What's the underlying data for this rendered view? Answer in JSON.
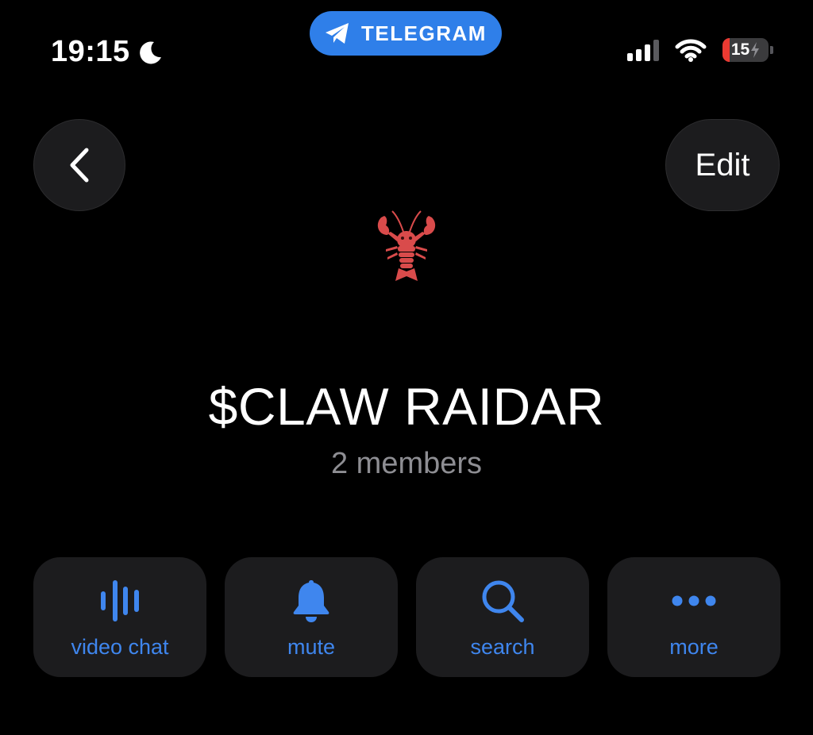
{
  "status_bar": {
    "time": "19:15",
    "app_pill_label": "TELEGRAM",
    "battery_level": "15",
    "battery_fraction": 0.15,
    "accent": "#2f7fe9"
  },
  "nav": {
    "back_icon": "chevron-left-icon",
    "edit_label": "Edit"
  },
  "profile": {
    "avatar_icon": "lobster-icon",
    "title": "$CLAW RAIDAR",
    "subtitle": "2 members"
  },
  "actions": [
    {
      "label": "video chat",
      "icon": "voice-wave-icon"
    },
    {
      "label": "mute",
      "icon": "bell-icon"
    },
    {
      "label": "search",
      "icon": "search-icon"
    },
    {
      "label": "more",
      "icon": "more-dots-icon"
    }
  ],
  "colors": {
    "background": "#000000",
    "card": "#1c1c1e",
    "action_blue": "#3f86ee",
    "secondary_text": "#8e8e93",
    "battery_low": "#ea3a32"
  }
}
